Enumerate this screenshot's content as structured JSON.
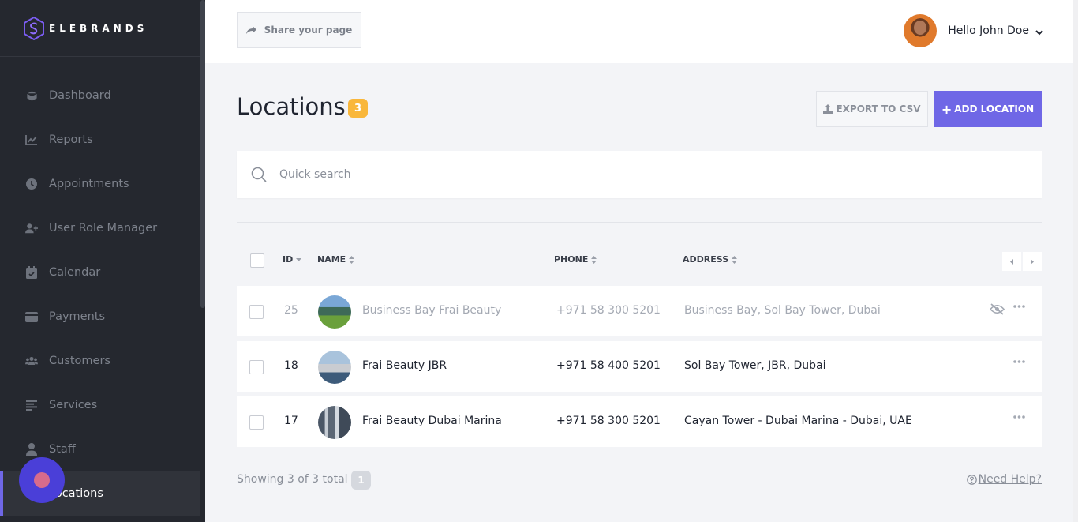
{
  "brand": {
    "name": "ELEBRANDS",
    "accent": "#6f67e6"
  },
  "sidebar": {
    "items": [
      {
        "label": "Dashboard",
        "icon": "cube-icon"
      },
      {
        "label": "Reports",
        "icon": "chart-line-icon"
      },
      {
        "label": "Appointments",
        "icon": "clock-icon"
      },
      {
        "label": "User Role Manager",
        "icon": "user-plus-icon"
      },
      {
        "label": "Calendar",
        "icon": "calendar-icon"
      },
      {
        "label": "Payments",
        "icon": "wallet-icon"
      },
      {
        "label": "Customers",
        "icon": "users-icon"
      },
      {
        "label": "Services",
        "icon": "list-icon"
      },
      {
        "label": "Staff",
        "icon": "user-icon"
      },
      {
        "label": "Locations",
        "icon": "map-marker-icon",
        "active": true
      }
    ]
  },
  "topbar": {
    "share_label": "Share your page",
    "user_greeting": "Hello John Doe"
  },
  "main": {
    "title": "Locations",
    "count": "3",
    "export_label": "EXPORT TO CSV",
    "add_label": "ADD LOCATION",
    "search": {
      "placeholder": "Quick search",
      "value": ""
    }
  },
  "table": {
    "columns": {
      "id": "ID",
      "name": "NAME",
      "phone": "PHONE",
      "address": "ADDRESS"
    },
    "rows": [
      {
        "id": "25",
        "name": "Business Bay Frai Beauty",
        "phone": "+971 58 300 5201",
        "address": "Business Bay, Sol Bay Tower, Dubai",
        "hidden": true
      },
      {
        "id": "18",
        "name": "Frai Beauty JBR",
        "phone": "+971 58 400 5201",
        "address": "Sol Bay Tower, JBR, Dubai",
        "hidden": false
      },
      {
        "id": "17",
        "name": "Frai Beauty Dubai Marina",
        "phone": "+971 58 300 5201",
        "address": "Cayan Tower - Dubai Marina - Dubai, UAE",
        "hidden": false
      }
    ]
  },
  "footer": {
    "showing": "Showing 3 of 3 total",
    "page": "1",
    "help": "Need Help?"
  }
}
